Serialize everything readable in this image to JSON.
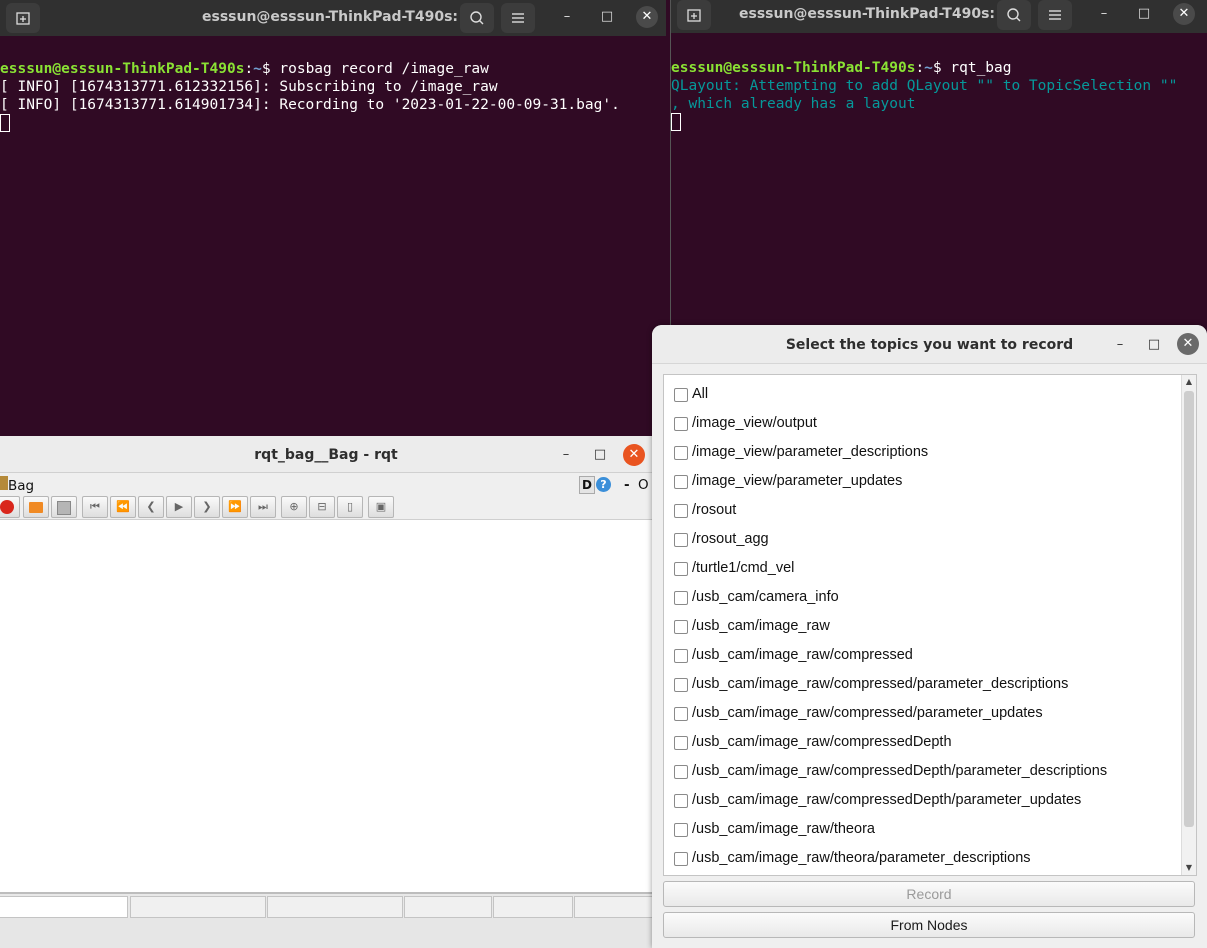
{
  "terminal_left": {
    "title": "esssun@esssun-ThinkPad-T490s: ~",
    "prompt_user": "esssun@esssun-ThinkPad-T490s",
    "prompt_sep": ":",
    "prompt_path": "~",
    "prompt_dollar": "$ ",
    "command": "rosbag record /image_raw",
    "lines": [
      "[ INFO] [1674313771.612332156]: Subscribing to /image_raw",
      "[ INFO] [1674313771.614901734]: Recording to '2023-01-22-00-09-31.bag'."
    ]
  },
  "terminal_right": {
    "title": "esssun@esssun-ThinkPad-T490s: ~",
    "prompt_user": "esssun@esssun-ThinkPad-T490s",
    "prompt_sep": ":",
    "prompt_path": "~",
    "prompt_dollar": "$ ",
    "command": "rqt_bag",
    "warning_lines": [
      "QLayout: Attempting to add QLayout \"\" to TopicSelection \"\"",
      ", which already has a layout"
    ]
  },
  "icons": {
    "new_tab": "new-tab-icon",
    "search": "search-icon",
    "menu": "hamburger-menu-icon",
    "minimize": "minimize-icon",
    "maximize": "maximize-icon",
    "close": "close-icon"
  },
  "rqt_window": {
    "title": "rqt_bag__Bag - rqt",
    "plugin_label": "Bag",
    "d_label": "D",
    "help_label": "?",
    "dash_label": "-",
    "o_label": "O"
  },
  "dialog": {
    "title": "Select the topics you want to record",
    "topics": [
      "All",
      "/image_view/output",
      "/image_view/parameter_descriptions",
      "/image_view/parameter_updates",
      "/rosout",
      "/rosout_agg",
      "/turtle1/cmd_vel",
      "/usb_cam/camera_info",
      "/usb_cam/image_raw",
      "/usb_cam/image_raw/compressed",
      "/usb_cam/image_raw/compressed/parameter_descriptions",
      "/usb_cam/image_raw/compressed/parameter_updates",
      "/usb_cam/image_raw/compressedDepth",
      "/usb_cam/image_raw/compressedDepth/parameter_descriptions",
      "/usb_cam/image_raw/compressedDepth/parameter_updates",
      "/usb_cam/image_raw/theora",
      "/usb_cam/image_raw/theora/parameter_descriptions"
    ],
    "record_label": "Record",
    "from_nodes_label": "From Nodes"
  },
  "colors": {
    "terminal_bg": "#300a24",
    "prompt_user": "#8ae234",
    "prompt_path": "#729fcf",
    "warning_text": "#06989a",
    "close_accent": "#e95420"
  }
}
